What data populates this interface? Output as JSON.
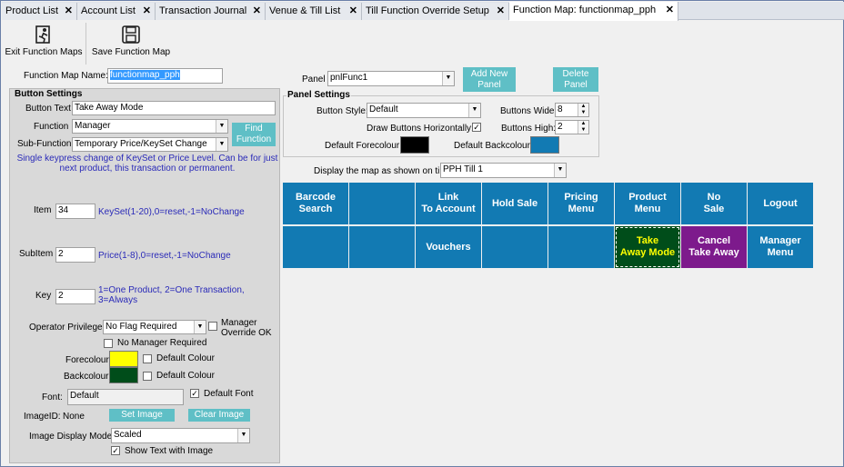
{
  "tabs": [
    {
      "label": "Product List"
    },
    {
      "label": "Account List"
    },
    {
      "label": "Transaction Journal"
    },
    {
      "label": "Venue & Till List"
    },
    {
      "label": "Till Function Override Setup"
    },
    {
      "label": "Function Map: functionmap_pph"
    }
  ],
  "tab_close": "✕",
  "toolbar": {
    "exit_label": "Exit Function Maps",
    "save_label": "Save Function Map"
  },
  "map_name": {
    "label": "Function Map Name:",
    "value": "functionmap_pph"
  },
  "panel": {
    "label": "Panel",
    "value": "pnlFunc1",
    "add_label": "Add New\nPanel",
    "delete_label": "Delete\nPanel"
  },
  "panel_settings": {
    "title": "Panel Settings",
    "button_style_label": "Button Style:",
    "button_style_value": "Default",
    "buttons_wide_label": "Buttons Wide:",
    "buttons_wide_value": "8",
    "draw_horiz_label": "Draw Buttons Horizontally:",
    "draw_horiz_checked": "✓",
    "buttons_high_label": "Buttons High:",
    "buttons_high_value": "2",
    "fore_label": "Default Forecolour",
    "back_label": "Default Backcolour",
    "fore_color": "#000000",
    "back_color": "#127ab3"
  },
  "display_map": {
    "label": "Display the map as shown on till:",
    "value": "PPH Till 1"
  },
  "button_settings": {
    "title": "Button Settings",
    "text_label": "Button Text",
    "text_value": "Take Away Mode",
    "function_label": "Function",
    "function_value": "Manager",
    "find_label": "Find\nFunction",
    "subfunction_label": "Sub-Function",
    "subfunction_value": "Temporary Price/KeySet Change",
    "description": "Single keypress change of KeySet or Price Level. Can be for just next product, this transaction or permanent.",
    "item_label": "Item",
    "item_value": "34",
    "item_hint": "KeySet(1-20),0=reset,-1=NoChange",
    "subitem_label": "SubItem",
    "subitem_value": "2",
    "subitem_hint": "Price(1-8),0=reset,-1=NoChange",
    "key_label": "Key",
    "key_value": "2",
    "key_hint": "1=One Product, 2=One Transaction, 3=Always",
    "privilege_label": "Operator Privilege:",
    "privilege_value": "No Flag Required",
    "override_label": "Manager\nOverride OK",
    "no_manager_label": "No Manager Required",
    "forecolour_label": "Forecolour",
    "backcolour_label": "Backcolour",
    "default_colour_label": "Default Colour",
    "fore_color": "#ffff00",
    "back_color": "#004d1a",
    "font_label": "Font:",
    "font_value": "Default",
    "default_font_label": "Default Font",
    "default_font_checked": "✓",
    "image_label": "ImageID:",
    "image_value": "None",
    "set_image_label": "Set Image",
    "clear_image_label": "Clear Image",
    "display_mode_label": "Image Display Mode:",
    "display_mode_value": "Scaled",
    "show_text_label": "Show Text with Image",
    "show_text_checked": "✓"
  },
  "accent_color": "#5fbfc6",
  "grid_buttons": [
    {
      "label": "Barcode\nSearch",
      "bg": "#127ab3",
      "fg": "#ffffff"
    },
    {
      "label": "",
      "bg": "#127ab3",
      "fg": "#ffffff"
    },
    {
      "label": "Link\nTo Account",
      "bg": "#127ab3",
      "fg": "#ffffff"
    },
    {
      "label": "Hold Sale",
      "bg": "#127ab3",
      "fg": "#ffffff"
    },
    {
      "label": "Pricing\nMenu",
      "bg": "#127ab3",
      "fg": "#ffffff"
    },
    {
      "label": "Product\nMenu",
      "bg": "#127ab3",
      "fg": "#ffffff"
    },
    {
      "label": "No\nSale",
      "bg": "#127ab3",
      "fg": "#ffffff"
    },
    {
      "label": "Logout",
      "bg": "#127ab3",
      "fg": "#ffffff"
    },
    {
      "label": "",
      "bg": "#127ab3",
      "fg": "#ffffff"
    },
    {
      "label": "",
      "bg": "#127ab3",
      "fg": "#ffffff"
    },
    {
      "label": "Vouchers",
      "bg": "#127ab3",
      "fg": "#ffffff"
    },
    {
      "label": "",
      "bg": "#127ab3",
      "fg": "#ffffff"
    },
    {
      "label": "",
      "bg": "#127ab3",
      "fg": "#ffffff"
    },
    {
      "label": "Take\nAway Mode",
      "bg": "#004d1a",
      "fg": "#ffff00",
      "selected": true
    },
    {
      "label": "Cancel\nTake Away",
      "bg": "#7d1a8c",
      "fg": "#ffffff"
    },
    {
      "label": "Manager\nMenu",
      "bg": "#127ab3",
      "fg": "#ffffff"
    }
  ]
}
